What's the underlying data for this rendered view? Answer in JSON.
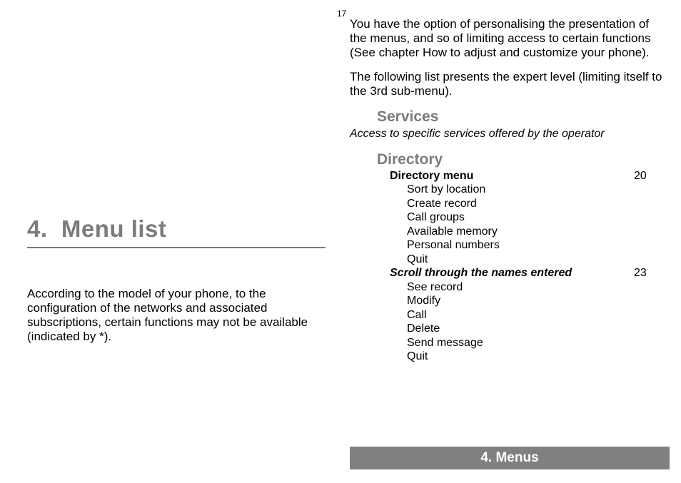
{
  "page_number": "17",
  "chapter": {
    "number": "4.",
    "title": "Menu list"
  },
  "left_intro": "According to the model of your phone, to the configuration of the networks and associated subscriptions, certain functions may not be available (indicated by *).",
  "right": {
    "para1": "You have the option of personalising the presentation of the menus, and so of limiting access to certain functions (See chapter How to adjust and customize your phone).",
    "para2": "The following list presents the expert level (limiting itself to the 3rd sub-menu).",
    "services": {
      "heading": "Services",
      "sub": "Access to specific services offered by the operator"
    },
    "directory": {
      "heading": "Directory",
      "group1": {
        "title": "Directory menu",
        "page": "20",
        "items": [
          "Sort by location",
          "Create record",
          "Call groups",
          "Available memory",
          "Personal numbers",
          "Quit"
        ]
      },
      "group2": {
        "title": "Scroll through the names entered",
        "page": "23",
        "items": [
          "See record",
          "Modify",
          "Call",
          "Delete",
          "Send message",
          "Quit"
        ]
      }
    }
  },
  "footer": "4. Menus"
}
